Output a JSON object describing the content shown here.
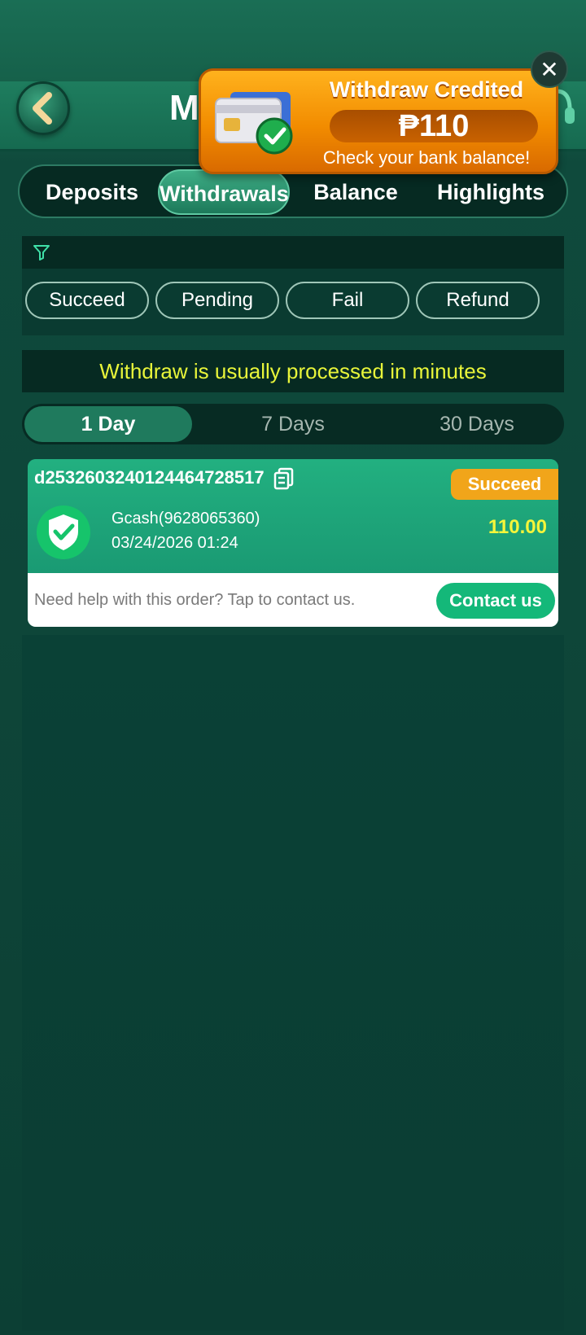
{
  "header": {
    "title": "My",
    "back_icon": "chevron-left-icon",
    "support_icon": "headset-icon"
  },
  "tabs": [
    {
      "label": "Deposits",
      "active": false
    },
    {
      "label": "Withdrawals",
      "active": true
    },
    {
      "label": "Balance",
      "active": false
    },
    {
      "label": "Highlights",
      "active": false
    }
  ],
  "filter": {
    "icon": "filter-icon",
    "chips": [
      "Succeed",
      "Pending",
      "Fail",
      "Refund"
    ]
  },
  "notice": "Withdraw is usually processed in minutes",
  "ranges": [
    {
      "label": "1 Day",
      "active": true
    },
    {
      "label": "7 Days",
      "active": false
    },
    {
      "label": "30 Days",
      "active": false
    }
  ],
  "record": {
    "order_id": "d2532603240124464728517",
    "status": "Succeed",
    "account": "Gcash(9628065360)",
    "datetime": "03/24/2026 01:24",
    "amount": "110.00",
    "help_text": "Need help with this order? Tap to contact us.",
    "contact_label": "Contact us"
  },
  "toast": {
    "title": "Withdraw Credited",
    "amount": "₱110",
    "subtitle": "Check your bank balance!",
    "close_symbol": "✕"
  },
  "colors": {
    "accent": "#1fa27a",
    "notice": "#e8f53a",
    "status": "#f1a51a",
    "amount": "#f5f53a",
    "toast": "#f28c00"
  }
}
